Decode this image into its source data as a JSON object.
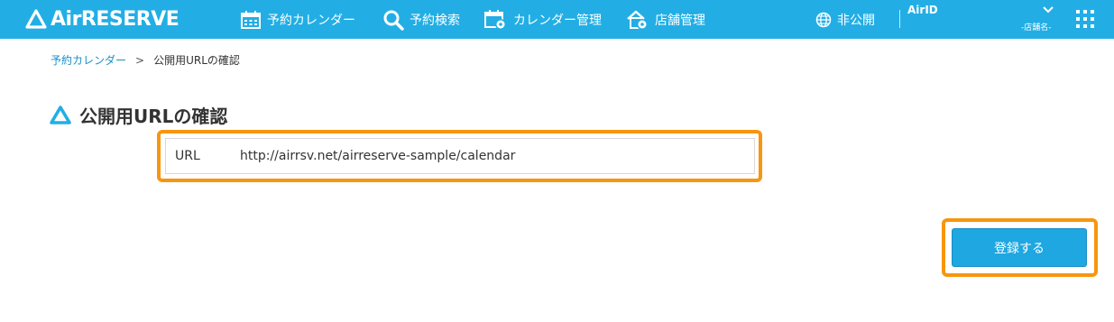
{
  "header": {
    "logo_text": "AirRESERVE",
    "nav": [
      {
        "label": "予約カレンダー",
        "icon": "calendar-icon"
      },
      {
        "label": "予約検索",
        "icon": "search-icon"
      },
      {
        "label": "カレンダー管理",
        "icon": "calendar-settings-icon"
      },
      {
        "label": "店舗管理",
        "icon": "store-settings-icon"
      }
    ],
    "visibility_label": "非公開",
    "visibility_icon": "globe-icon",
    "account_label": "AirID",
    "store_label": "-店舗名-",
    "bg_color": "#22aee5"
  },
  "breadcrumb": {
    "parent": "予約カレンダー",
    "separator": ">",
    "current": "公開用URLの確認"
  },
  "page": {
    "title": "公開用URLの確認",
    "url_label": "URL",
    "url_value": "http://airrsv.net/airreserve-sample/calendar",
    "register_button": "登録する",
    "highlight_color": "#f7960f"
  }
}
